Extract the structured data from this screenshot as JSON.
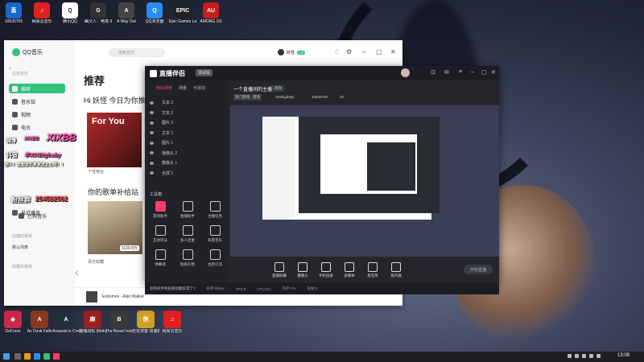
{
  "desktop_icons_top": [
    {
      "label": "10630765",
      "color": "#1a66cc",
      "glyph": "直"
    },
    {
      "label": "网易云音乐",
      "color": "#e02020",
      "glyph": "♫"
    },
    {
      "label": "腾讯QQ",
      "color": "#ffffff",
      "glyph": "Q"
    },
    {
      "label": "幽灵人：绝境 周末版",
      "color": "#333333",
      "glyph": "G"
    },
    {
      "label": "A Way Out",
      "color": "#444444",
      "glyph": "A"
    },
    {
      "label": "QQ浏览器",
      "color": "#2a8cf0",
      "glyph": "Q"
    },
    {
      "label": "Epic Games Launcher",
      "color": "#222222",
      "glyph": "EPIC"
    },
    {
      "label": "AMONG US",
      "color": "#c81b1b",
      "glyph": "AU"
    }
  ],
  "desktop_icons_bottom": [
    {
      "label": "GeForce",
      "color": "#c8284a",
      "glyph": "◆"
    },
    {
      "label": "As Dusk Falls",
      "color": "#8a3a20",
      "glyph": "A"
    },
    {
      "label": "Assassin's Creed Va...",
      "color": "#23303e",
      "glyph": "A"
    },
    {
      "label": "魔魂战机 (Mahjong...",
      "color": "#9a2020",
      "glyph": "麻"
    },
    {
      "label": "The Beast Inside",
      "color": "#3a3a3a",
      "glyph": "B"
    },
    {
      "label": "无名侠客 快速捷径",
      "color": "#d0a020",
      "glyph": "侠"
    },
    {
      "label": "网易云音乐",
      "color": "#e02020",
      "glyph": "♫"
    }
  ],
  "qqmusic": {
    "app_name": "QQ音乐",
    "search_placeholder": "搜索音乐",
    "username": "妖怪",
    "vip": "VIP",
    "sidebar_section_online": "在线音乐",
    "sidebar_items": [
      "推荐",
      "音乐馆",
      "视频",
      "电台"
    ],
    "sidebar_section_mine": "我的音乐",
    "sidebar_items_mine": [
      "本地和下载",
      "最近播放",
      "已购音乐"
    ],
    "sidebar_section_created": "创建的歌单",
    "playlist_default": "默认列表",
    "sidebar_section_collected": "收藏的歌单",
    "page_title": "推荐",
    "greeting": "Hi 妖怪 今日为你推荐",
    "card1_caption": "个性电台",
    "card1_art_text": "For You",
    "section_2": "你的歌单补给站",
    "card2_plays": "1129.8万",
    "card2_caption": "百万收藏",
    "now_playing": "Extremes - Alan Walker"
  },
  "overlay": {
    "brand": "XIXBB",
    "weibo_label": "微博",
    "weibo_id": "XIXBB",
    "douyin_label": "抖音",
    "douyin_id": "丰XIXBigbaby",
    "note": "感人！全能音乐家家居上心呀！！",
    "group_label": "粉丝群",
    "group_id": "254582562"
  },
  "zhibo": {
    "title": "直播伴侣",
    "badge": "测试版",
    "tabs": [
      "我的场景",
      "场景",
      "可添加"
    ],
    "scenes": [
      "文本 3",
      "文本 2",
      "图片 2",
      "文本 1",
      "图片 1",
      "摄像头 2",
      "摄像头 1",
      "全屏 1"
    ],
    "tools_title": "工具箱",
    "tools": [
      "游戏助手",
      "直播助手",
      "主播任务",
      "互动玩法",
      "多人连麦",
      "背景音乐",
      "弹幕墙",
      "贴纸礼物",
      "拉新引流"
    ],
    "stream_title": "一个直播间的主播",
    "stream_tag": "修改",
    "tags": [
      "热门游戏 · 游戏",
      "XIXBigbaby",
      "10630765"
    ],
    "viewers": "40",
    "bottom_buttons": [
      "直播屏幕",
      "摄像头",
      "手机投屏",
      "多媒体",
      "麦克风",
      "扬声器"
    ],
    "go_live": "开始直播",
    "status_warning": "您的对手机投屏功能异常了?",
    "status_items": [
      "码率:0kbps",
      "FPS:0",
      "CPU:0%",
      "内存:0%",
      "丢帧:0"
    ]
  },
  "taskbar": {
    "time": "13:09"
  }
}
